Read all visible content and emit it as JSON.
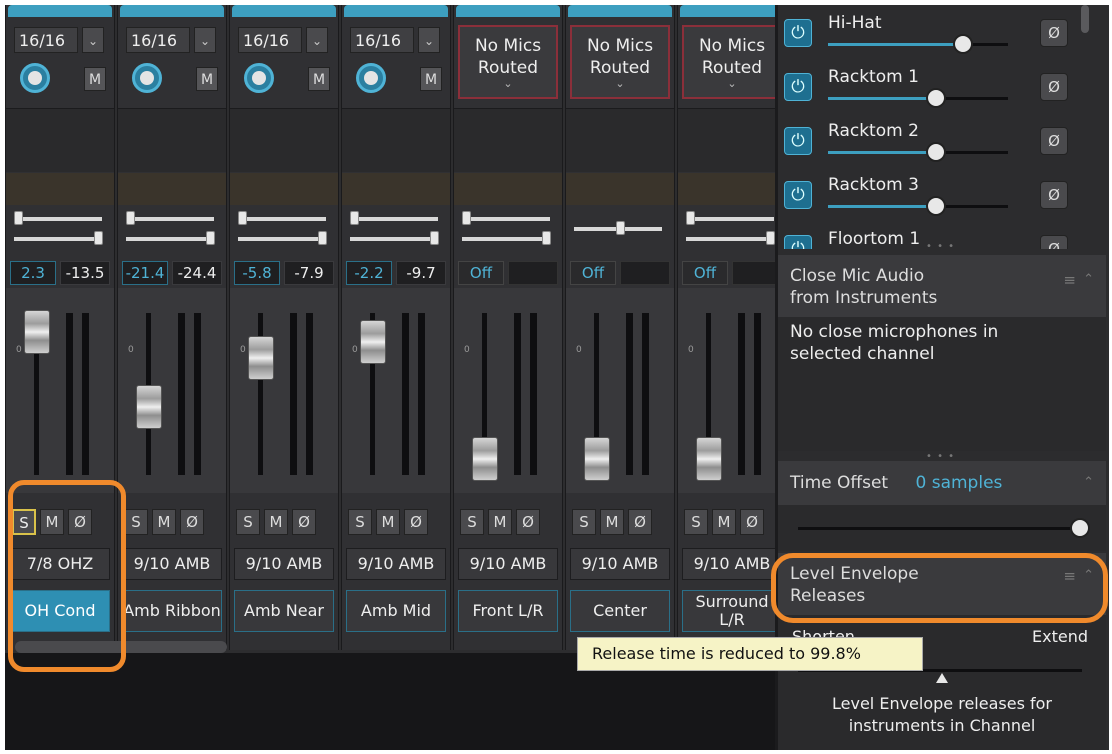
{
  "strips": [
    {
      "type": "mic",
      "channel": "16/16",
      "mute": "M",
      "val1": "2.3",
      "val2": "-13.5",
      "solo": "S",
      "mute2": "M",
      "phase": "Ø",
      "assign": "7/8 OHZ",
      "name": "OH Cond",
      "selected": true,
      "solo_on": true,
      "fader_level": 0.88
    },
    {
      "type": "mic",
      "channel": "16/16",
      "mute": "M",
      "val1": "-21.4",
      "val2": "-24.4",
      "solo": "S",
      "mute2": "M",
      "phase": "Ø",
      "assign": "9/10 AMB",
      "name": "Amb Ribbon",
      "selected": false,
      "solo_on": false,
      "fader_level": 0.42
    },
    {
      "type": "mic",
      "channel": "16/16",
      "mute": "M",
      "val1": "-5.8",
      "val2": "-7.9",
      "solo": "S",
      "mute2": "M",
      "phase": "Ø",
      "assign": "9/10 AMB",
      "name": "Amb Near",
      "selected": false,
      "solo_on": false,
      "fader_level": 0.72
    },
    {
      "type": "mic",
      "channel": "16/16",
      "mute": "M",
      "val1": "-2.2",
      "val2": "-9.7",
      "solo": "S",
      "mute2": "M",
      "phase": "Ø",
      "assign": "9/10 AMB",
      "name": "Amb Mid",
      "selected": false,
      "solo_on": false,
      "fader_level": 0.82
    },
    {
      "type": "nomics",
      "nomics": "No Mics Routed",
      "val1": "Off",
      "solo": "S",
      "mute2": "M",
      "phase": "Ø",
      "assign": "9/10 AMB",
      "name": "Front L/R",
      "selected": false,
      "solo_on": false,
      "fader_level": 0.1
    },
    {
      "type": "nomics",
      "nomics": "No Mics Routed",
      "val1": "Off",
      "solo": "S",
      "mute2": "M",
      "phase": "Ø",
      "assign": "9/10 AMB",
      "name": "Center",
      "selected": false,
      "solo_on": false,
      "fader_level": 0.1
    },
    {
      "type": "nomics",
      "nomics": "No Mics Routed",
      "val1": "Off",
      "solo": "S",
      "mute2": "M",
      "phase": "Ø",
      "assign": "9/10 AMB",
      "name": "Surround L/R",
      "selected": false,
      "solo_on": false,
      "fader_level": 0.1
    }
  ],
  "instruments": [
    {
      "name": "Hi-Hat",
      "power": "⏻",
      "phase": "Ø",
      "level": 0.75
    },
    {
      "name": "Racktom 1",
      "power": "⏻",
      "phase": "Ø",
      "level": 0.6
    },
    {
      "name": "Racktom 2",
      "power": "⏻",
      "phase": "Ø",
      "level": 0.6
    },
    {
      "name": "Racktom 3",
      "power": "⏻",
      "phase": "Ø",
      "level": 0.6
    },
    {
      "name": "Floortom 1",
      "power": "⏻",
      "phase": "Ø",
      "level": 0.6
    }
  ],
  "close_mic": {
    "title_line1": "Close Mic Audio",
    "title_line2": "from Instruments",
    "message_line1": "No close microphones in",
    "message_line2": "selected channel"
  },
  "time_offset": {
    "label": "Time Offset",
    "value": "0 samples"
  },
  "level_env": {
    "title_line1": "Level Envelope",
    "title_line2": "Releases",
    "shorten": "Shorten",
    "extend": "Extend",
    "tooltip": "Release time is reduced to 99.8%",
    "desc_line1": "Level Envelope releases for",
    "desc_line2": "instruments in Channel"
  },
  "icons": {
    "hamburger": "≡",
    "collapse": "⌃",
    "grip": "• • •"
  },
  "colors": {
    "accent": "#3d9fc0",
    "highlight": "#f08a2c",
    "tooltip_bg": "#f6f3c6"
  }
}
